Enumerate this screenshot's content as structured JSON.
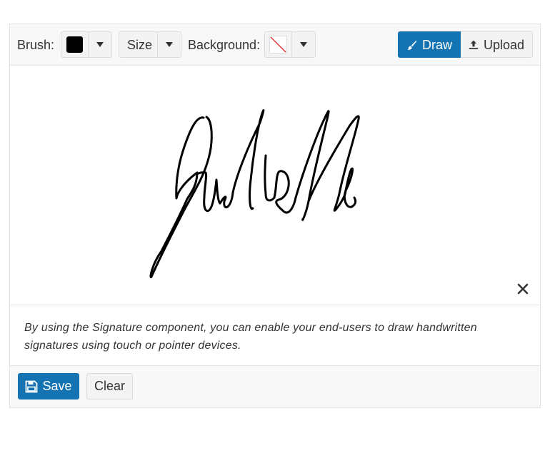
{
  "toolbar": {
    "brush_label": "Brush:",
    "brush_color": "#000000",
    "size_label": "Size",
    "background_label": "Background:",
    "background_value": "none",
    "mode_buttons": [
      {
        "label": "Draw",
        "icon": "brush-icon",
        "active": true
      },
      {
        "label": "Upload",
        "icon": "upload-icon",
        "active": false
      }
    ]
  },
  "canvas": {
    "signature_text": "Juliette",
    "clear_icon": "close-icon"
  },
  "description": "By using the Signature component, you can enable your end-users to draw handwritten signatures using touch or pointer devices.",
  "footer": {
    "save_label": "Save",
    "save_icon": "save-icon",
    "clear_label": "Clear"
  },
  "colors": {
    "primary": "#1474b3",
    "toolbar_bg": "#f8f8f8",
    "border": "#e3e3e3"
  }
}
